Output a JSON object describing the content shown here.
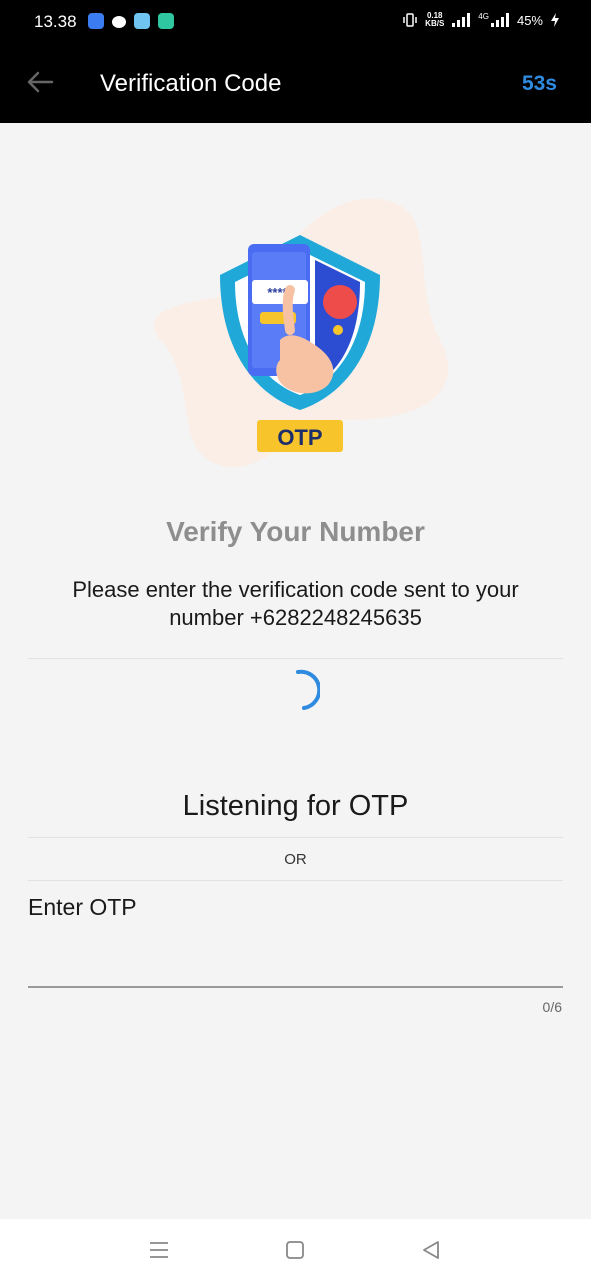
{
  "status_bar": {
    "time": "13.38",
    "net_speed_value": "0.18",
    "net_speed_unit": "KB/S",
    "network_type": "4G",
    "battery": "45%",
    "notification_icons": [
      "app-icon-blue",
      "reddit-icon",
      "robot-app-icon",
      "calculator-icon"
    ]
  },
  "app_bar": {
    "title": "Verification Code",
    "timer": "53s",
    "back_icon": "arrow-left-icon"
  },
  "illustration": {
    "masked_code": "*****",
    "badge": "OTP"
  },
  "main": {
    "heading": "Verify Your Number",
    "instruction": "Please enter the verification code sent to your number +6282248245635",
    "listening": "Listening for OTP",
    "or": "OR"
  },
  "otp_field": {
    "label": "Enter OTP",
    "value": "",
    "counter": "0/6"
  },
  "nav_bar": {
    "icons": [
      "menu-icon",
      "home-icon",
      "back-icon"
    ]
  },
  "colors": {
    "accent": "#2e8be0",
    "header_bg": "#000000",
    "page_bg": "#f4f4f4",
    "heading_gray": "#8e8e8e",
    "phone_blue": "#4a6cf2",
    "shield_cyan": "#1fa8d8",
    "badge_yellow": "#f7c52b",
    "red_dot": "#ee4b4b"
  }
}
